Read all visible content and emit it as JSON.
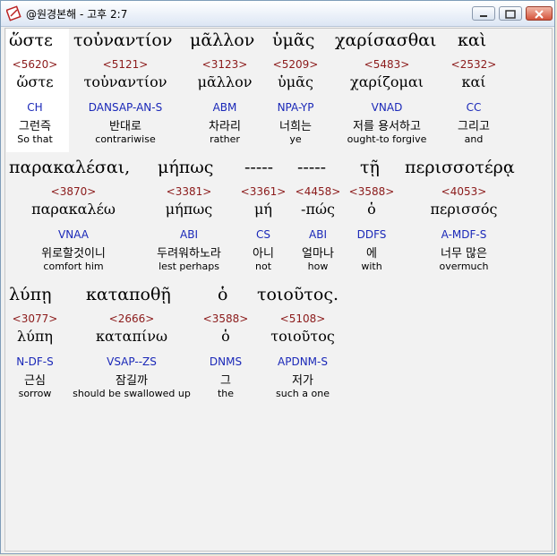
{
  "window": {
    "title": "@원경본해 - 고후 2:7"
  },
  "rows": [
    {
      "greek": [
        "ὥστε",
        "τοὐναντίον",
        "μᾶλλον",
        "ὑμᾶς",
        "χαρίσασθαι",
        "καὶ"
      ],
      "words": [
        {
          "strong": "<5620>",
          "lemma": "ὥστε",
          "parse": "CH",
          "kor": "그런즉",
          "eng": "So that"
        },
        {
          "strong": "<5121>",
          "lemma": "τοὐναντίον",
          "parse": "DANSAP-AN-S",
          "kor": "반대로",
          "eng": "contrariwise"
        },
        {
          "strong": "<3123>",
          "lemma": "μᾶλλον",
          "parse": "ABM",
          "kor": "차라리",
          "eng": "rather"
        },
        {
          "strong": "<5209>",
          "lemma": "ὑμᾶς",
          "parse": "NPA-YP",
          "kor": "너희는",
          "eng": "ye"
        },
        {
          "strong": "<5483>",
          "lemma": "χαρίζομαι",
          "parse": "VNAD",
          "kor": "저를 용서하고",
          "eng": "ought-to forgive"
        },
        {
          "strong": "<2532>",
          "lemma": "καί",
          "parse": "CC",
          "kor": "그리고",
          "eng": "and"
        }
      ]
    },
    {
      "greek": [
        "παρακαλέσαι,",
        "μήπως",
        "-----",
        "-----",
        "τῇ",
        "περισσοτέρᾳ"
      ],
      "words": [
        {
          "strong": "<3870>",
          "lemma": "παρακαλέω",
          "parse": "VNAA",
          "kor": "위로할것이니",
          "eng": "comfort him"
        },
        {
          "strong": "<3381>",
          "lemma": "μήπως",
          "parse": "ABI",
          "kor": "두려워하노라",
          "eng": "lest perhaps"
        },
        {
          "strong": "<3361>",
          "lemma": "μή",
          "parse": "CS",
          "kor": "아니",
          "eng": "not"
        },
        {
          "strong": "<4458>",
          "lemma": "-πώς",
          "parse": "ABI",
          "kor": "얼마나",
          "eng": "how"
        },
        {
          "strong": "<3588>",
          "lemma": "ὁ",
          "parse": "DDFS",
          "kor": "에",
          "eng": "with"
        },
        {
          "strong": "<4053>",
          "lemma": "περισσός",
          "parse": "A-MDF-S",
          "kor": "너무 많은",
          "eng": "overmuch"
        }
      ]
    },
    {
      "greek": [
        "λύπῃ",
        "καταποθῇ",
        "ὁ",
        "τοιοῦτος."
      ],
      "words": [
        {
          "strong": "<3077>",
          "lemma": "λύπη",
          "parse": "N-DF-S",
          "kor": "근심",
          "eng": "sorrow"
        },
        {
          "strong": "<2666>",
          "lemma": "καταπίνω",
          "parse": "VSAP--ZS",
          "kor": "잠길까",
          "eng": "should be swallowed up"
        },
        {
          "strong": "<3588>",
          "lemma": "ὁ",
          "parse": "DNMS",
          "kor": "그",
          "eng": "the"
        },
        {
          "strong": "<5108>",
          "lemma": "τοιοῦτος",
          "parse": "APDNM-S",
          "kor": "저가",
          "eng": "such a one"
        }
      ]
    }
  ]
}
